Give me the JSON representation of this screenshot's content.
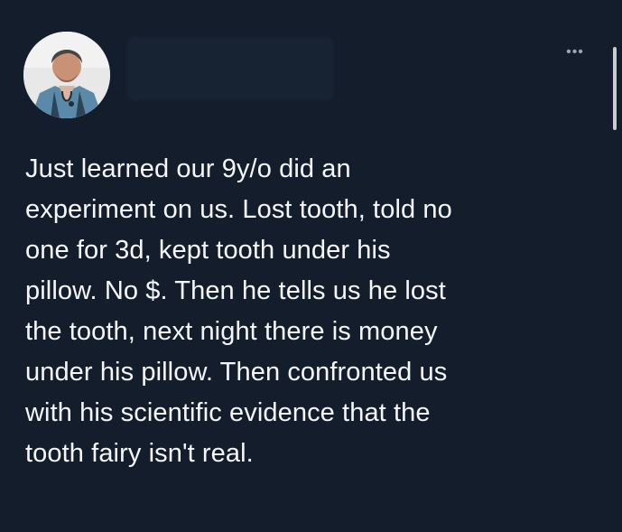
{
  "post": {
    "text": "Just learned our 9y/o did an\nexperiment on us.  Lost tooth, told no\none for 3d, kept tooth under his\npillow.  No $.  Then he tells us he lost\nthe tooth, next night there is money\nunder his pillow.  Then confronted us\nwith his scientific evidence that the\ntooth fairy isn't real.",
    "more_icon": "more-options-icon"
  },
  "colors": {
    "background": "#141d2b",
    "text": "#f5f7fa",
    "muted": "#9aa7b5"
  }
}
